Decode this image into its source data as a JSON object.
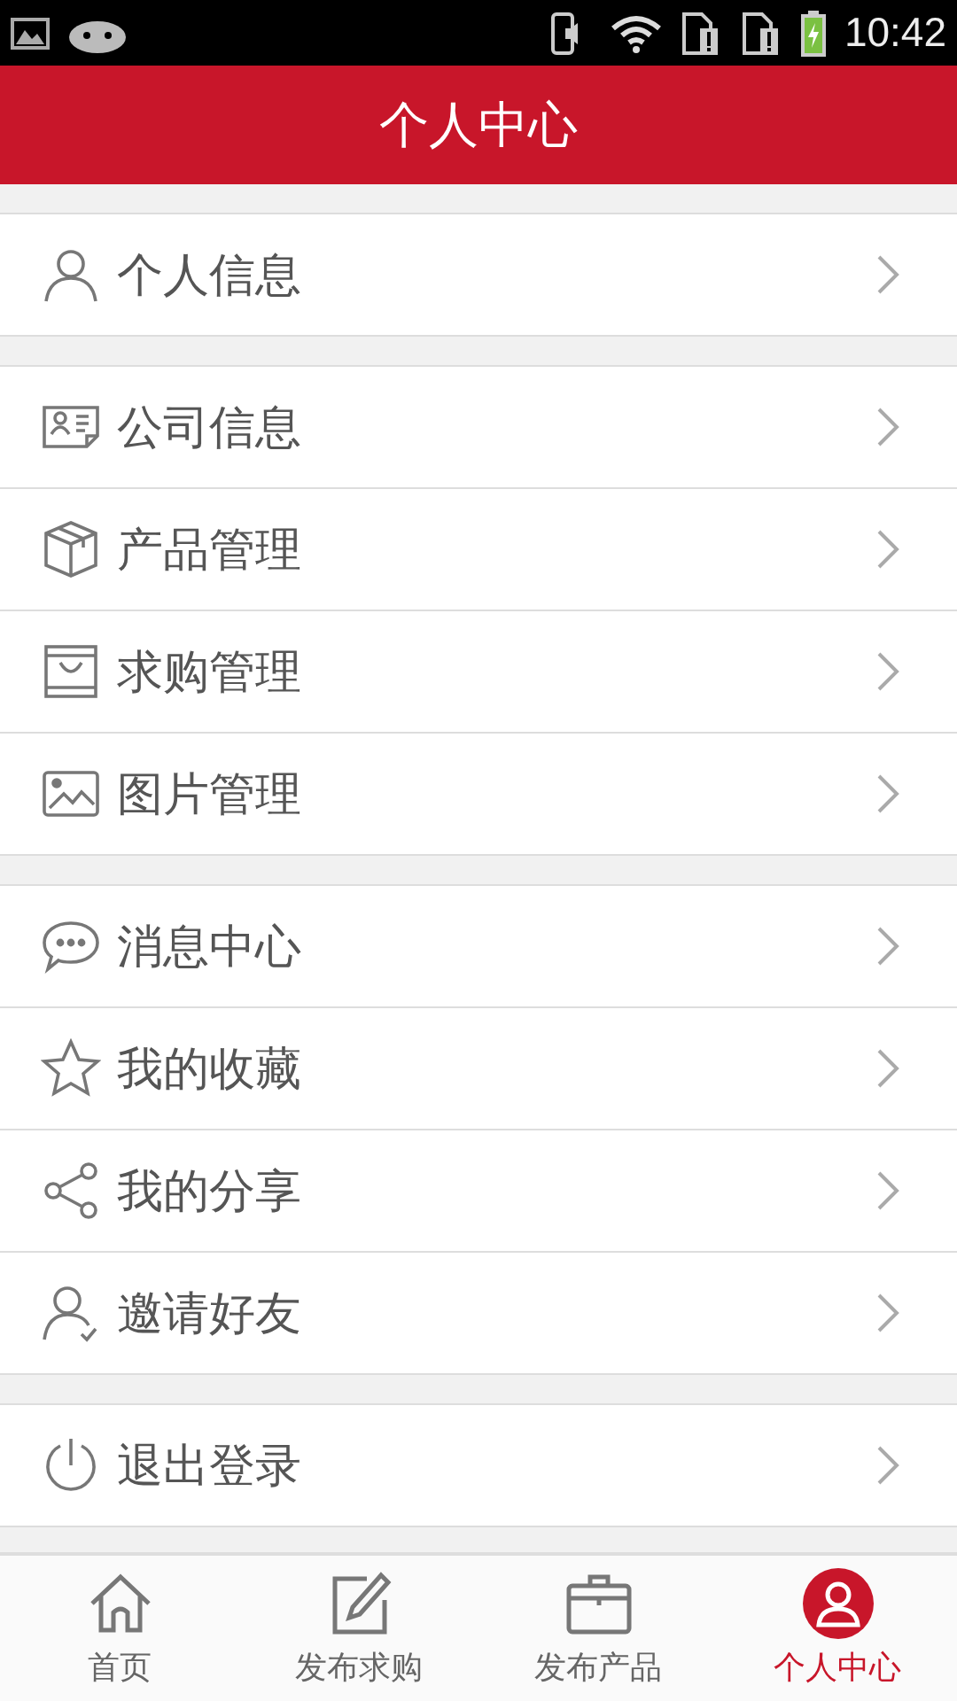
{
  "status_bar": {
    "time": "10:42"
  },
  "header": {
    "title": "个人中心"
  },
  "groups": [
    {
      "items": [
        {
          "kind": "person",
          "label": "个人信息"
        }
      ]
    },
    {
      "items": [
        {
          "kind": "card",
          "label": "公司信息"
        },
        {
          "kind": "box",
          "label": "产品管理"
        },
        {
          "kind": "bag",
          "label": "求购管理"
        },
        {
          "kind": "image",
          "label": "图片管理"
        }
      ]
    },
    {
      "items": [
        {
          "kind": "chat",
          "label": "消息中心"
        },
        {
          "kind": "star",
          "label": "我的收藏"
        },
        {
          "kind": "share",
          "label": "我的分享"
        },
        {
          "kind": "invite",
          "label": "邀请好友"
        }
      ]
    },
    {
      "items": [
        {
          "kind": "power",
          "label": "退出登录"
        }
      ]
    }
  ],
  "tab_bar": [
    {
      "kind": "home",
      "label": "首页",
      "selected": false
    },
    {
      "kind": "edit",
      "label": "发布求购",
      "selected": false
    },
    {
      "kind": "briefcase",
      "label": "发布产品",
      "selected": false
    },
    {
      "kind": "user",
      "label": "个人中心",
      "selected": true
    }
  ]
}
